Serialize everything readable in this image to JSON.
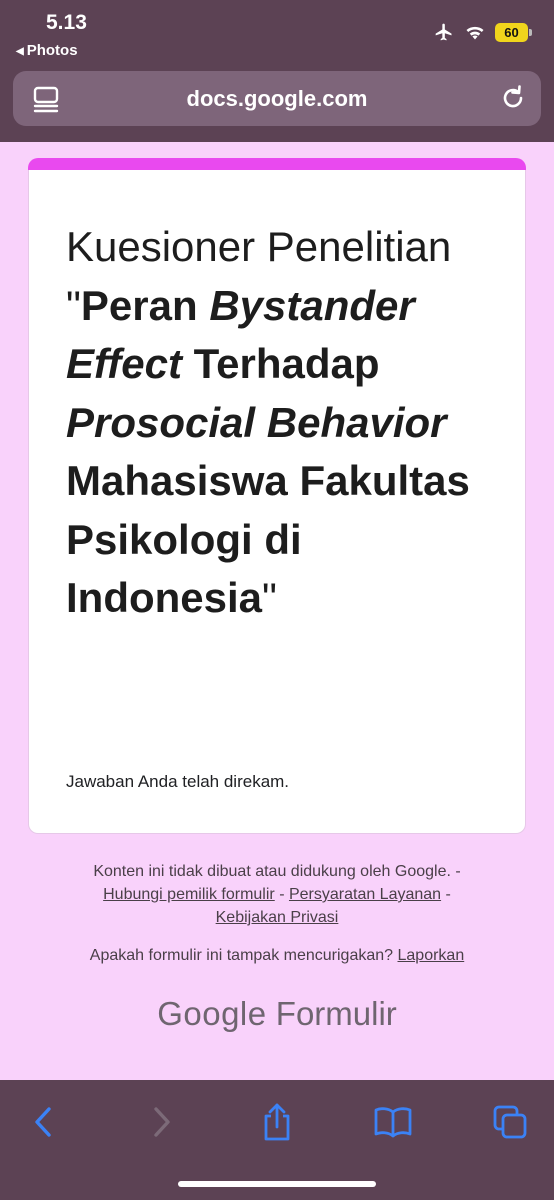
{
  "status": {
    "time": "5.13",
    "back_label": "Photos",
    "battery": "60"
  },
  "browser": {
    "url": "docs.google.com",
    "icons": {
      "reader": "reader-mode-icon",
      "reload": "reload-icon",
      "back": "chevron-left-icon",
      "forward": "chevron-right-icon",
      "share": "share-icon",
      "bookmarks": "book-icon",
      "tabs": "tabs-icon"
    },
    "accent_color": "#3b82f6"
  },
  "form": {
    "title_part1": "Kuesioner Penelitian \"",
    "title_part2": "Peran ",
    "title_part3": "Bystander Effect",
    "title_part4": " Terhadap ",
    "title_part5": "Prosocial Behavior",
    "title_part6": " Mahasiswa Fakultas Psikologi di Indonesia",
    "title_part7": "\"",
    "confirmation": "Jawaban Anda telah direkam.",
    "header_color": "#e949ef",
    "background_color": "#f9d2fb"
  },
  "footer": {
    "disclaimer": "Konten ini tidak dibuat atau didukung oleh Google. -",
    "link_contact": "Hubungi pemilik formulir",
    "sep1": " - ",
    "link_terms": "Persyaratan Layanan",
    "sep2": " -",
    "link_privacy": "Kebijakan Privasi",
    "report_question": "Apakah formulir ini tampak mencurigakan?",
    "link_report": "Laporkan",
    "brand_google": "Google",
    "brand_forms": "Formulir"
  }
}
